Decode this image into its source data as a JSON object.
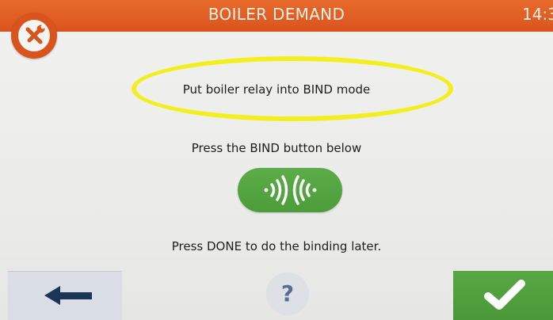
{
  "header": {
    "title": "BOILER DEMAND",
    "clock": "14:3"
  },
  "content": {
    "step1": "Put boiler relay into BIND mode",
    "step2": "Press the BIND button below",
    "step3": "Press DONE to do the binding later."
  },
  "nav": {
    "help_label": "?"
  },
  "icons": {
    "settings": "tools-icon",
    "bind": "bind-signal-icon",
    "back": "arrow-left-icon",
    "done": "checkmark-icon"
  },
  "colors": {
    "header": "#d9541c",
    "highlight": "#f3ef1c",
    "bind_button": "#52a33f",
    "done_button": "#4f9f3c",
    "back_button": "#d9dee6",
    "help_text": "#5a6f8f"
  }
}
